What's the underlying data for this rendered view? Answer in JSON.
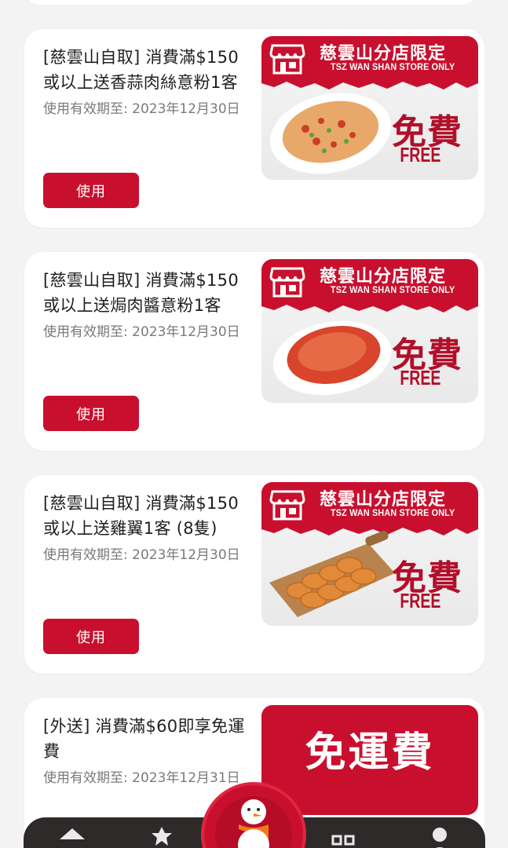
{
  "coupons": [
    {
      "title": "[慈雲山自取] 消費滿$150或以上送香蒜肉絲意粉1客",
      "valid": "使用有效期至: 2023年12月30日",
      "button": "使用",
      "banner_zh": "慈雲山分店限定",
      "banner_en": "TSZ WAN SHAN STORE ONLY",
      "free_zh": "免費",
      "free_en": "FREE",
      "dish": "garlic-pork-spaghetti"
    },
    {
      "title": "[慈雲山自取] 消費滿$150或以上送焗肉醬意粉1客",
      "valid": "使用有效期至: 2023年12月30日",
      "button": "使用",
      "banner_zh": "慈雲山分店限定",
      "banner_en": "TSZ WAN SHAN STORE ONLY",
      "free_zh": "免費",
      "free_en": "FREE",
      "dish": "baked-bolognese"
    },
    {
      "title": "[慈雲山自取] 消費滿$150或以上送雞翼1客 (8隻)",
      "valid": "使用有效期至: 2023年12月30日",
      "button": "使用",
      "banner_zh": "慈雲山分店限定",
      "banner_en": "TSZ WAN SHAN STORE ONLY",
      "free_zh": "免費",
      "free_en": "FREE",
      "dish": "chicken-wings"
    },
    {
      "title": "[外送] 消費滿$60即享免運費",
      "valid": "使用有效期至: 2023年12月31日",
      "banner_zh": "免運費"
    }
  ],
  "nav": {
    "items": [
      "home-icon",
      "gift-icon",
      "snowman-icon",
      "qr-code-icon",
      "profile-icon"
    ]
  },
  "colors": {
    "brand_red": "#c8102e",
    "nav_bg": "#2e2a2a",
    "page_bg": "#f3f3f4"
  }
}
